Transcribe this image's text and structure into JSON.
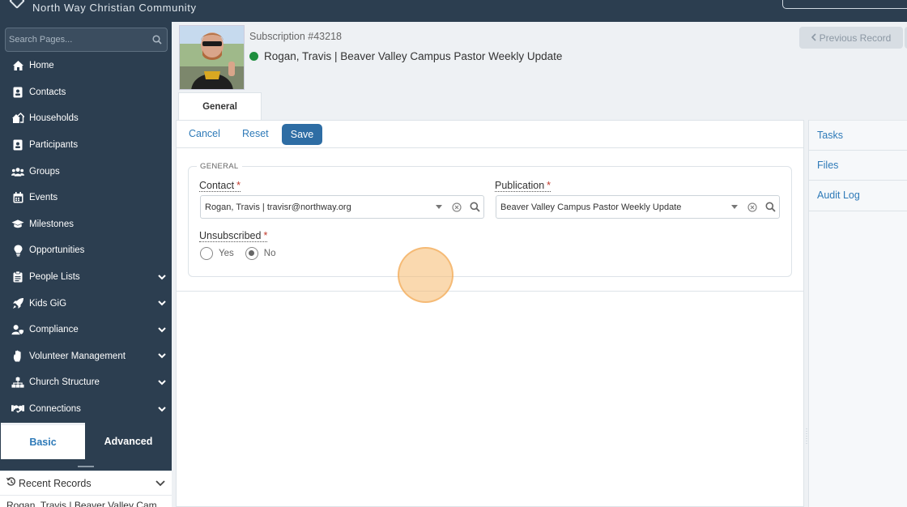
{
  "topbar": {
    "org_name": "North Way Christian Community"
  },
  "sidebar": {
    "search_placeholder": "Search Pages...",
    "items": [
      {
        "label": "Home",
        "icon": "home-icon",
        "expandable": false
      },
      {
        "label": "Contacts",
        "icon": "contact-card-icon",
        "expandable": false
      },
      {
        "label": "Households",
        "icon": "households-icon",
        "expandable": false
      },
      {
        "label": "Participants",
        "icon": "participant-icon",
        "expandable": false
      },
      {
        "label": "Groups",
        "icon": "groups-icon",
        "expandable": false
      },
      {
        "label": "Events",
        "icon": "calendar-icon",
        "expandable": false
      },
      {
        "label": "Milestones",
        "icon": "graduation-cap-icon",
        "expandable": false
      },
      {
        "label": "Opportunities",
        "icon": "lightbulb-icon",
        "expandable": false
      },
      {
        "label": "People Lists",
        "icon": "clipboard-icon",
        "expandable": true
      },
      {
        "label": "Kids GiG",
        "icon": "rocket-icon",
        "expandable": true
      },
      {
        "label": "Compliance",
        "icon": "user-shield-icon",
        "expandable": true
      },
      {
        "label": "Volunteer Management",
        "icon": "hand-icon",
        "expandable": true
      },
      {
        "label": "Church Structure",
        "icon": "sitemap-icon",
        "expandable": true
      },
      {
        "label": "Connections",
        "icon": "handshake-icon",
        "expandable": true
      }
    ],
    "modes": {
      "basic": "Basic",
      "advanced": "Advanced",
      "active": "basic"
    },
    "recent": {
      "title": "Recent Records",
      "items": [
        "Rogan, Travis | Beaver Valley Cam"
      ]
    }
  },
  "record": {
    "subtitle": "Subscription #43218",
    "title": "Rogan, Travis | Beaver Valley Campus Pastor Weekly Update",
    "status_color": "#1e8e3e",
    "prev_label": "Previous Record"
  },
  "tabs": [
    {
      "label": "General",
      "active": true
    }
  ],
  "toolbar": {
    "cancel": "Cancel",
    "reset": "Reset",
    "save": "Save"
  },
  "form": {
    "legend": "GENERAL",
    "contact": {
      "label": "Contact",
      "value": "Rogan, Travis | travisr@northway.org"
    },
    "publication": {
      "label": "Publication",
      "value": "Beaver Valley Campus Pastor Weekly Update"
    },
    "unsubscribed": {
      "label": "Unsubscribed",
      "options": [
        "Yes",
        "No"
      ],
      "selected": "No"
    },
    "required_marker": "*"
  },
  "right_panel": {
    "items": [
      "Tasks",
      "Files",
      "Audit Log"
    ]
  },
  "colors": {
    "sidebar_bg": "#2c3e50",
    "accent": "#2e7ab8",
    "save_bg": "#2e6da4"
  }
}
